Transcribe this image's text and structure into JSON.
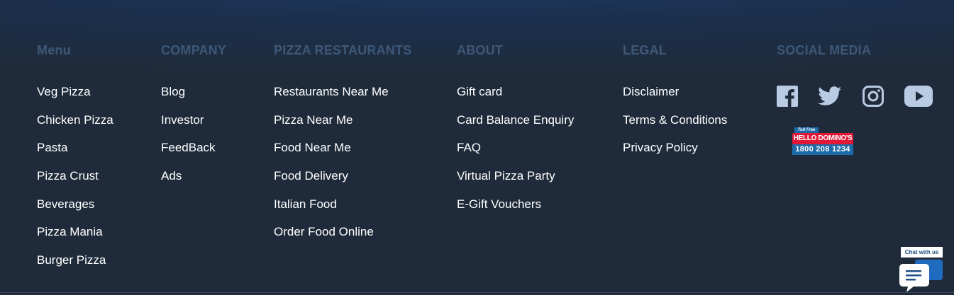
{
  "columns": {
    "menu": {
      "heading": "Menu",
      "items": [
        "Veg Pizza",
        "Chicken Pizza",
        "Pasta",
        "Pizza Crust",
        "Beverages",
        "Pizza Mania",
        "Burger Pizza"
      ]
    },
    "company": {
      "heading": "COMPANY",
      "items": [
        "Blog",
        "Investor",
        "FeedBack",
        "Ads"
      ]
    },
    "restaurants": {
      "heading": "PIZZA RESTAURANTS",
      "items": [
        "Restaurants Near Me",
        "Pizza Near Me",
        "Food Near Me",
        "Food Delivery",
        "Italian Food",
        "Order Food Online"
      ]
    },
    "about": {
      "heading": "ABOUT",
      "items": [
        "Gift card",
        "Card Balance Enquiry",
        "FAQ",
        "Virtual Pizza Party",
        "E-Gift Vouchers"
      ]
    },
    "legal": {
      "heading": "LEGAL",
      "items": [
        "Disclaimer",
        "Terms & Conditions",
        "Privacy Policy"
      ]
    },
    "social": {
      "heading": "SOCIAL MEDIA",
      "icons": [
        "facebook-icon",
        "twitter-icon",
        "instagram-icon",
        "youtube-icon"
      ]
    }
  },
  "helpline": {
    "toll_free": "Toll Free",
    "name": "HELLO DOMINO'S",
    "number": "1800 208 1234"
  },
  "chat": {
    "label": "Chat with us"
  },
  "colors": {
    "heading": "#3e5878",
    "link": "#ffffff",
    "icon": "#b9cbe3",
    "brand_red": "#e31837",
    "brand_blue": "#1d6aa8"
  }
}
